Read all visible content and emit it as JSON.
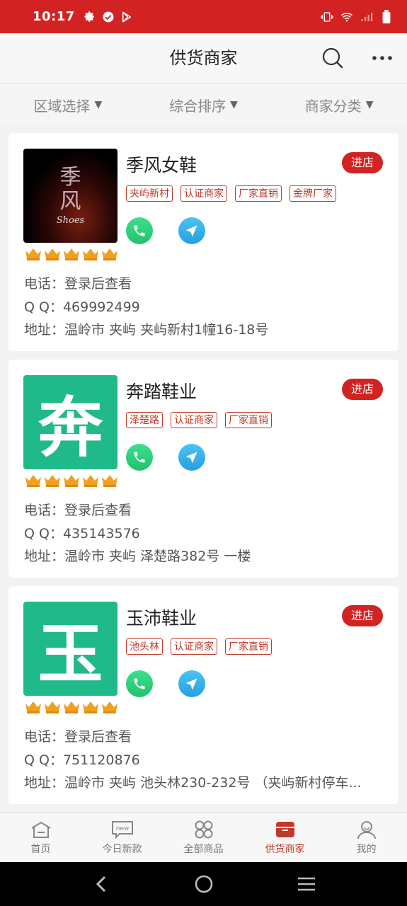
{
  "status_bar": {
    "time": "10:17",
    "left_icons": [
      "gear-icon",
      "check-circle-icon",
      "play-store-icon"
    ],
    "right_icons": [
      "vibrate-icon",
      "wifi-icon",
      "signal-icon",
      "battery-icon"
    ]
  },
  "header": {
    "title": "供货商家",
    "icons": [
      "search-icon",
      "more-icon"
    ]
  },
  "filters": [
    {
      "label": "区域选择"
    },
    {
      "label": "综合排序"
    },
    {
      "label": "商家分类"
    }
  ],
  "merchants": [
    {
      "name": "季风女鞋",
      "enter_label": "进店",
      "logo": {
        "type": "image",
        "chars": [
          "季",
          "风"
        ],
        "sub": "Shoes"
      },
      "tags": [
        "夹屿新村",
        "认证商家",
        "厂家直销",
        "金牌厂家"
      ],
      "rating_crowns": 5,
      "phone": "电话：登录后查看",
      "qq": "Q Q：469992499",
      "address": "地址：温岭市 夹屿 夹屿新村1幢16-18号"
    },
    {
      "name": "奔踏鞋业",
      "enter_label": "进店",
      "logo": {
        "type": "letter",
        "char": "奔"
      },
      "tags": [
        "泽楚路",
        "认证商家",
        "厂家直销"
      ],
      "rating_crowns": 5,
      "phone": "电话：登录后查看",
      "qq": "Q Q：435143576",
      "address": "地址：温岭市 夹屿 泽楚路382号 一楼"
    },
    {
      "name": "玉沛鞋业",
      "enter_label": "进店",
      "logo": {
        "type": "letter",
        "char": "玉"
      },
      "tags": [
        "池头林",
        "认证商家",
        "厂家直销"
      ],
      "rating_crowns": 5,
      "phone": "电话：登录后查看",
      "qq": "Q Q：751120876",
      "address": "地址：温岭市 夹屿 池头林230-232号 （夹屿新村停车..."
    }
  ],
  "bottom_nav": [
    {
      "label": "首页",
      "icon": "home-icon",
      "active": false
    },
    {
      "label": "今日新款",
      "icon": "new-icon",
      "active": false
    },
    {
      "label": "全部商品",
      "icon": "grid-icon",
      "active": false
    },
    {
      "label": "供货商家",
      "icon": "store-icon",
      "active": true
    },
    {
      "label": "我的",
      "icon": "user-icon",
      "active": false
    }
  ],
  "system_nav": [
    "back-icon",
    "home-circle-icon",
    "menu-icon"
  ],
  "colors": {
    "accent": "#d22222",
    "tag": "#c0392b",
    "logo_green": "#20b98a",
    "crown": "#f0a020"
  }
}
